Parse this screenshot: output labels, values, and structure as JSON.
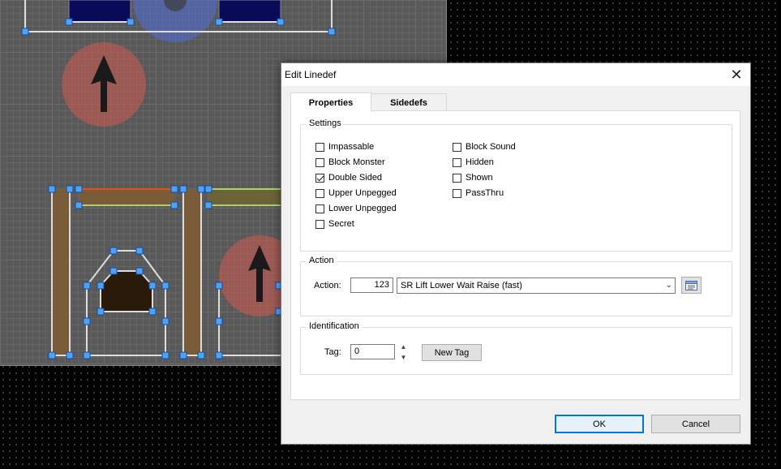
{
  "dialog": {
    "title": "Edit Linedef",
    "close_icon": "close-icon",
    "tabs": [
      {
        "label": "Properties",
        "active": true
      },
      {
        "label": "Sidedefs",
        "active": false
      }
    ],
    "settings": {
      "legend": "Settings",
      "flags_col1": [
        {
          "label": "Impassable",
          "checked": false
        },
        {
          "label": "Block Monster",
          "checked": false
        },
        {
          "label": "Double Sided",
          "checked": true
        },
        {
          "label": "Upper Unpegged",
          "checked": false
        },
        {
          "label": "Lower Unpegged",
          "checked": false
        },
        {
          "label": "Secret",
          "checked": false
        }
      ],
      "flags_col2": [
        {
          "label": "Block Sound",
          "checked": false
        },
        {
          "label": "Hidden",
          "checked": false
        },
        {
          "label": "Shown",
          "checked": false
        },
        {
          "label": "PassThru",
          "checked": false
        }
      ]
    },
    "action": {
      "legend": "Action",
      "label": "Action:",
      "number": "123",
      "selected": "SR Lift Lower Wait Raise (fast)",
      "browse_icon": "list-browse-icon"
    },
    "identification": {
      "legend": "Identification",
      "tag_label": "Tag:",
      "tag_value": "0",
      "new_tag_label": "New Tag"
    },
    "ok_label": "OK",
    "cancel_label": "Cancel"
  },
  "colors": {
    "dialog_bg": "#f0f0f0",
    "panel_bg": "#ffffff",
    "default_button_border": "#0078d7",
    "vertex_handle": "#4aa3ff",
    "thing_red": "#c0504d",
    "thing_blue": "#4a6fd1"
  }
}
